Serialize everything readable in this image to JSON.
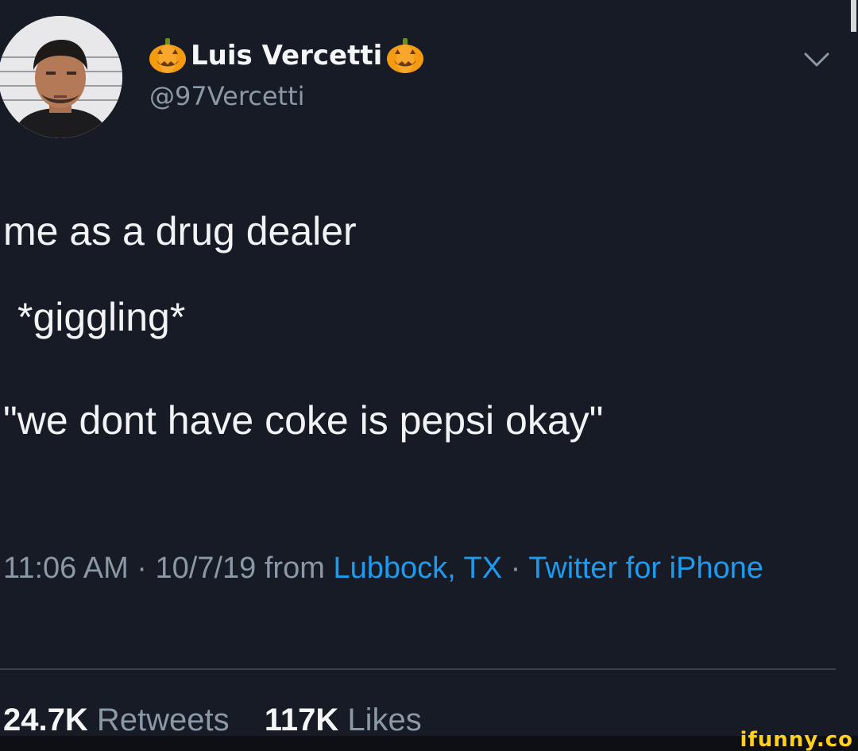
{
  "profile": {
    "display_name": "Luis Vercetti",
    "handle": "@97Vercetti",
    "emoji_name": "jack-o-lantern-icon"
  },
  "tweet": {
    "lines": [
      "me as a drug dealer",
      "*giggling*",
      "\"we dont have coke is pepsi okay\""
    ]
  },
  "meta": {
    "time": "11:06 AM",
    "separator": "·",
    "date": "10/7/19",
    "from_label": "from",
    "location": "Lubbock, TX",
    "client": "Twitter for iPhone"
  },
  "stats": {
    "retweets_count": "24.7K",
    "retweets_label": "Retweets",
    "likes_count": "117K",
    "likes_label": "Likes"
  },
  "watermark": "ifunny.co",
  "colors": {
    "background": "#161b25",
    "text_primary": "#f1f3f5",
    "text_secondary": "#8b98a5",
    "link": "#1d9bf0",
    "watermark": "#ffd01d"
  }
}
